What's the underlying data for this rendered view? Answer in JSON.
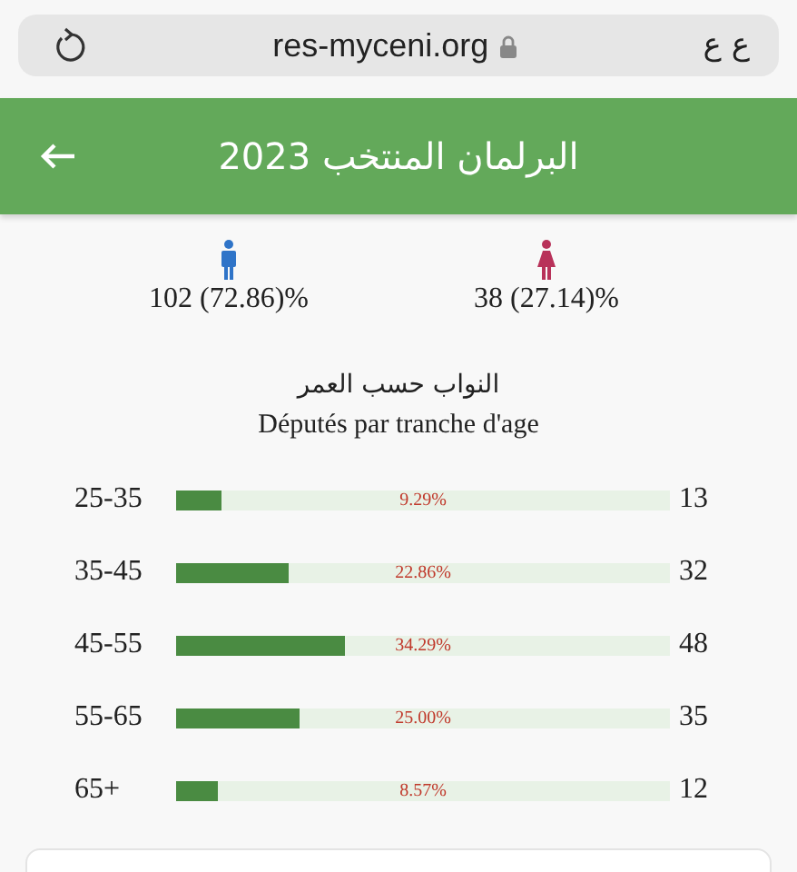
{
  "browser": {
    "url": "res-myceni.org",
    "text_size": "ع ع"
  },
  "header": {
    "title": "البرلمان المنتخب 2023"
  },
  "gender": [
    {
      "kind": "male",
      "text": "102 (72.86)%"
    },
    {
      "kind": "female",
      "text": "38 (27.14)%"
    }
  ],
  "section": {
    "title_ar": "النواب حسب العمر",
    "title_fr": "Députés par tranche d'age"
  },
  "age_groups": [
    {
      "range": "25-35",
      "level": 0.0929,
      "percent": "9.29%",
      "count": "13"
    },
    {
      "range": "35-45",
      "level": 0.2286,
      "percent": "22.86%",
      "count": "32"
    },
    {
      "range": "45-55",
      "level": 0.3429,
      "percent": "34.29%",
      "count": "48"
    },
    {
      "range": "55-65",
      "level": 0.25,
      "percent": "25.00%",
      "count": "35"
    },
    {
      "range": "65+",
      "level": 0.0857,
      "percent": "8.57%",
      "count": "12"
    }
  ]
}
